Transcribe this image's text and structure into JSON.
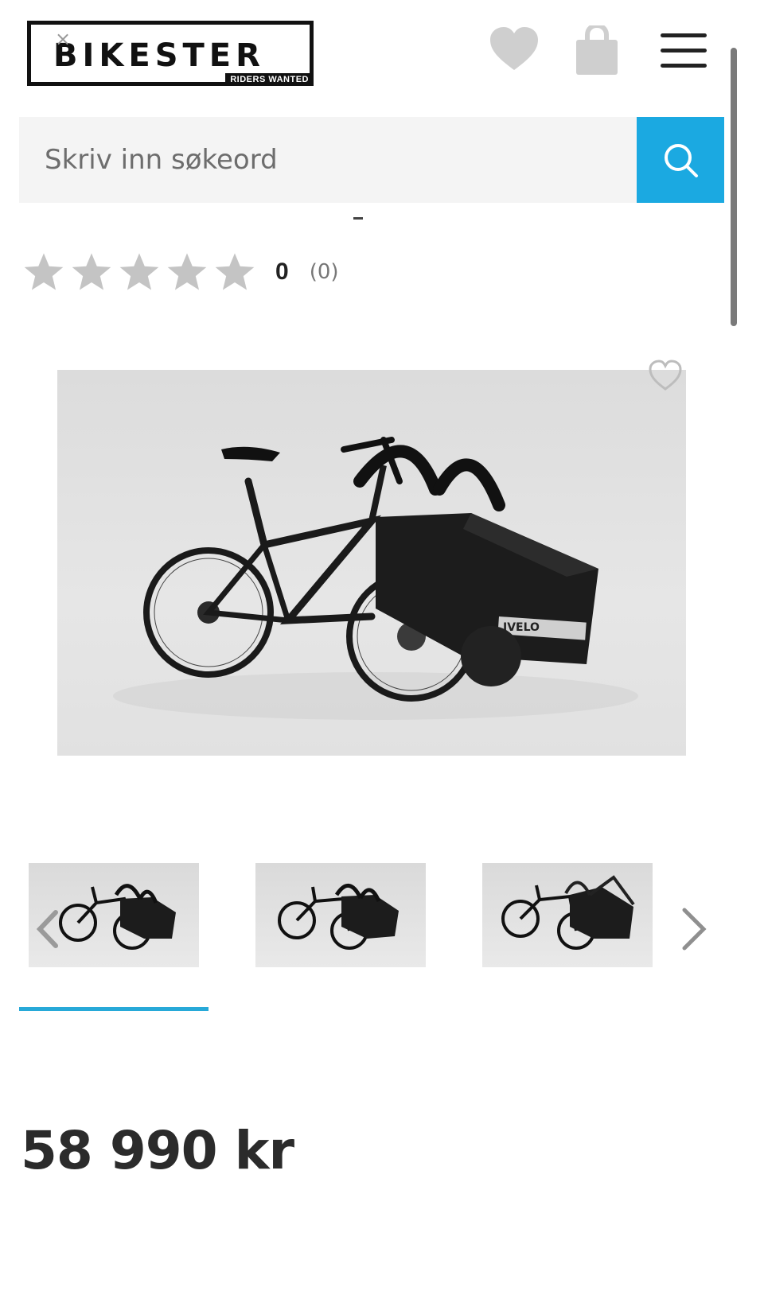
{
  "header": {
    "logo_text": "BIKESTER",
    "logo_tagline": "RIDERS WANTED",
    "close_glyph": "×",
    "icons": [
      "heart-icon",
      "shopping-bag-icon",
      "menu-icon"
    ]
  },
  "search": {
    "placeholder": "Skriv inn søkeord",
    "button_icon": "search-icon",
    "accent_color": "#1ba9e1"
  },
  "rating": {
    "stars": 5,
    "filled": 0,
    "value": "0",
    "count": "(0)"
  },
  "product": {
    "brand_on_box": "IVELO",
    "price": "58 990 kr"
  },
  "gallery": {
    "thumbnails": [
      "thumbnail-1",
      "thumbnail-2",
      "thumbnail-3"
    ],
    "progress_fraction": 0.27,
    "progress_color": "#27a9d8"
  }
}
